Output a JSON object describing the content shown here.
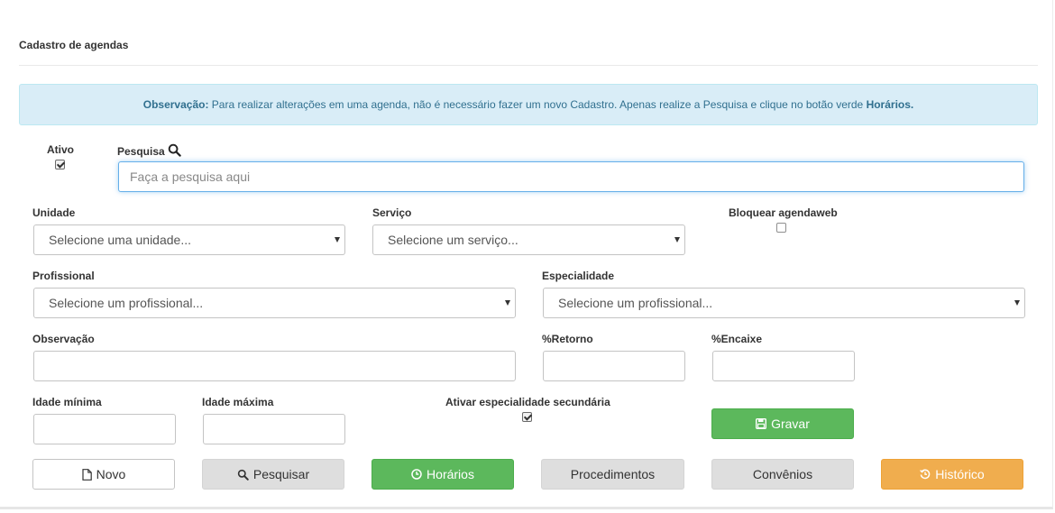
{
  "page": {
    "title": "Cadastro de agendas"
  },
  "alert": {
    "bold_prefix": "Observação:",
    "text": " Para realizar alterações em uma agenda, não é necessário fazer um novo Cadastro. Apenas realize a Pesquisa e clique no botão verde ",
    "bold_suffix": "Horários."
  },
  "ativo": {
    "label": "Ativo",
    "checked": true
  },
  "pesquisa": {
    "label": "Pesquisa",
    "placeholder": "Faça a pesquisa aqui",
    "value": ""
  },
  "unidade": {
    "label": "Unidade",
    "selected": "Selecione uma unidade..."
  },
  "servico": {
    "label": "Serviço",
    "selected": "Selecione um serviço..."
  },
  "bloquear": {
    "label": "Bloquear agendaweb",
    "checked": false
  },
  "profissional": {
    "label": "Profissional",
    "selected": "Selecione um profissional..."
  },
  "especialidade": {
    "label": "Especialidade",
    "selected": "Selecione um profissional..."
  },
  "observacao": {
    "label": "Observação",
    "value": ""
  },
  "retorno": {
    "label": "%Retorno",
    "value": ""
  },
  "encaixe": {
    "label": "%Encaixe",
    "value": ""
  },
  "idade_min": {
    "label": "Idade mínima",
    "value": ""
  },
  "idade_max": {
    "label": "Idade máxima",
    "value": ""
  },
  "secundaria": {
    "label": "Ativar especialidade secundária",
    "checked": true
  },
  "buttons": {
    "gravar": "Gravar",
    "novo": "Novo",
    "pesquisar": "Pesquisar",
    "horarios": "Horários",
    "procedimentos": "Procedimentos",
    "convenios": "Convênios",
    "historico": "Histórico"
  },
  "colors": {
    "alert_bg": "#d9edf7",
    "alert_text": "#31708f",
    "success": "#5cb85c",
    "warning": "#f0ad4e",
    "gray_button": "#dedede",
    "focus_border": "#66afe9"
  }
}
